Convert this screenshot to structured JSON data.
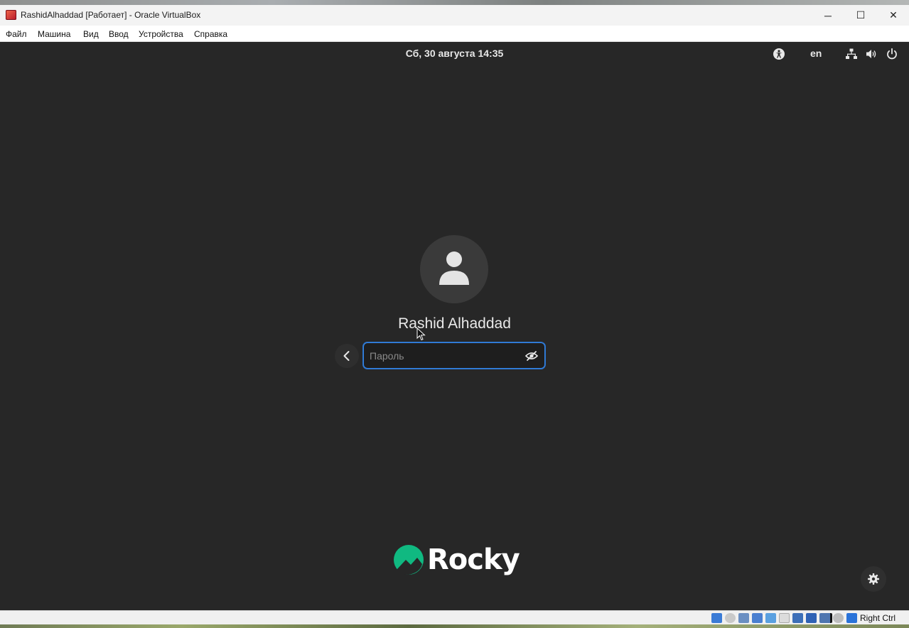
{
  "window": {
    "title": "RashidAlhaddad [Работает] - Oracle VirtualBox",
    "controls": {
      "minimize": "─",
      "maximize": "☐",
      "close": "✕"
    }
  },
  "menu": [
    "Файл",
    "Машина",
    "Вид",
    "Ввод",
    "Устройства",
    "Справка"
  ],
  "guest": {
    "clock": "Сб, 30 августа  14:35",
    "language": "en",
    "tray_icons": [
      "accessibility-icon",
      "network-icon",
      "volume-icon",
      "power-icon"
    ],
    "user": {
      "name": "Rashid Alhaddad"
    },
    "password": {
      "placeholder": "Пароль",
      "value": ""
    },
    "logo_text": "Rocky",
    "colors": {
      "background": "#272727",
      "focus": "#3584e4",
      "logo_green": "#10b981"
    }
  },
  "statusbar": {
    "host_key": "Right Ctrl",
    "icons": [
      "audio-icon",
      "optical-drive-icon",
      "usb-icon",
      "network-adapter-icon",
      "shared-folders-icon",
      "display-icon",
      "capture-icon",
      "virtualization-icon",
      "mouse-integration-icon",
      "keyboard-capture-icon"
    ]
  }
}
